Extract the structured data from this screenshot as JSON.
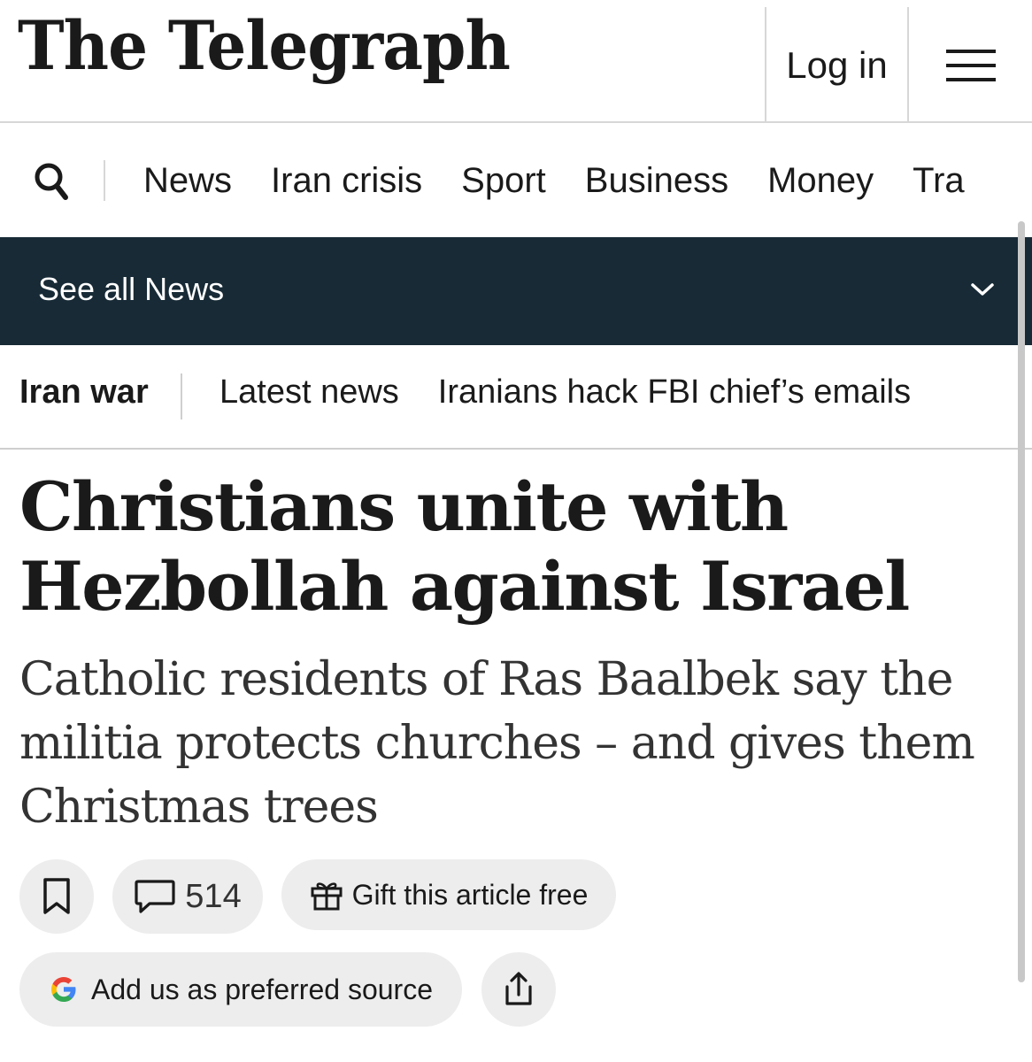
{
  "header": {
    "logo": "The Telegraph",
    "login_label": "Log in",
    "menu_icon": "hamburger-menu-icon"
  },
  "nav": {
    "search_icon": "search-icon",
    "items": [
      {
        "label": "News"
      },
      {
        "label": "Iran crisis"
      },
      {
        "label": "Sport"
      },
      {
        "label": "Business"
      },
      {
        "label": "Money"
      },
      {
        "label": "Tra"
      }
    ]
  },
  "section_bar": {
    "label": "See all News",
    "icon": "chevron-down-icon",
    "background": "#172a36"
  },
  "subnav": {
    "title": "Iran war",
    "items": [
      {
        "label": "Latest news"
      },
      {
        "label": "Iranians hack FBI chief’s emails"
      }
    ]
  },
  "article": {
    "headline": "Christians unite with Hezbollah against Israel",
    "standfirst": "Catholic residents of Ras Baalbek say the militia protects churches – and gives them Christmas trees"
  },
  "actions": {
    "save_icon": "bookmark-icon",
    "comments_icon": "comment-icon",
    "comments_count": "514",
    "gift_icon": "gift-icon",
    "gift_label": "Gift this article free",
    "source_icon": "google-icon",
    "source_label": "Add us as preferred source",
    "share_icon": "share-icon"
  }
}
